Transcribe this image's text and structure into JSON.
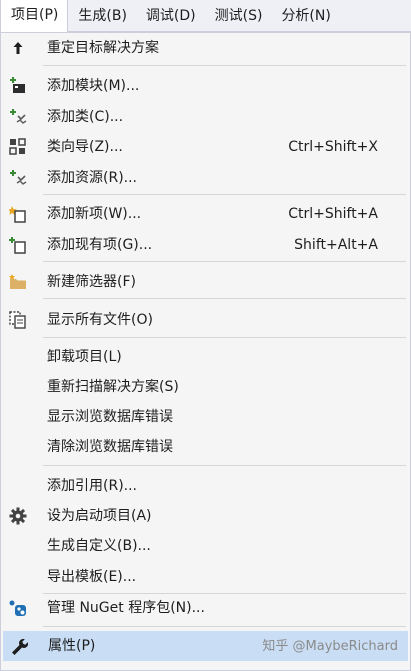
{
  "menubar": {
    "items": [
      {
        "label": "项目(P)"
      },
      {
        "label": "生成(B)"
      },
      {
        "label": "调试(D)"
      },
      {
        "label": "测试(S)"
      },
      {
        "label": "分析(N)"
      }
    ]
  },
  "menu": {
    "items": [
      {
        "label": "重定目标解决方案",
        "shortcut": "",
        "icon": "arrow-up-icon"
      },
      {
        "label": "添加模块(M)...",
        "shortcut": "",
        "icon": "add-module-icon"
      },
      {
        "label": "添加类(C)...",
        "shortcut": "",
        "icon": "add-class-icon"
      },
      {
        "label": "类向导(Z)...",
        "shortcut": "Ctrl+Shift+X",
        "icon": "class-wizard-icon"
      },
      {
        "label": "添加资源(R)...",
        "shortcut": "",
        "icon": "add-resource-icon"
      },
      {
        "label": "添加新项(W)...",
        "shortcut": "Ctrl+Shift+A",
        "icon": "add-new-item-icon"
      },
      {
        "label": "添加现有项(G)...",
        "shortcut": "Shift+Alt+A",
        "icon": "add-existing-item-icon"
      },
      {
        "label": "新建筛选器(F)",
        "shortcut": "",
        "icon": "new-filter-folder-icon"
      },
      {
        "label": "显示所有文件(O)",
        "shortcut": "",
        "icon": "show-all-files-icon"
      },
      {
        "label": "卸载项目(L)",
        "shortcut": "",
        "icon": ""
      },
      {
        "label": "重新扫描解决方案(S)",
        "shortcut": "",
        "icon": ""
      },
      {
        "label": "显示浏览数据库错误",
        "shortcut": "",
        "icon": ""
      },
      {
        "label": "清除浏览数据库错误",
        "shortcut": "",
        "icon": ""
      },
      {
        "label": "添加引用(R)...",
        "shortcut": "",
        "icon": ""
      },
      {
        "label": "设为启动项目(A)",
        "shortcut": "",
        "icon": "gear-icon"
      },
      {
        "label": "生成自定义(B)...",
        "shortcut": "",
        "icon": ""
      },
      {
        "label": "导出模板(E)...",
        "shortcut": "",
        "icon": ""
      },
      {
        "label": "管理 NuGet 程序包(N)...",
        "shortcut": "",
        "icon": "nuget-icon"
      },
      {
        "label": "属性(P)",
        "shortcut": "",
        "icon": "wrench-icon"
      }
    ]
  },
  "watermark": "知乎 @MaybeRichard",
  "colors": {
    "menubar_bg": "#eef0f5",
    "menu_bg": "#f5f5f5",
    "highlight": "#c9def5",
    "separator": "#d6d6d6"
  }
}
